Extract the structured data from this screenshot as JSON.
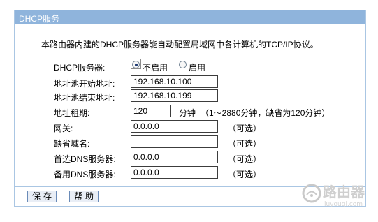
{
  "panel": {
    "title": "DHCP服务",
    "description": "本路由器内建的DHCP服务器能自动配置局域网中各计算机的TCP/IP协议。"
  },
  "dhcp_server": {
    "label": "DHCP服务器:",
    "options": [
      "不启用",
      "启用"
    ],
    "selected": "不启用"
  },
  "fields": {
    "start": {
      "label": "地址池开始地址:",
      "value": "192.168.10.100"
    },
    "end": {
      "label": "地址池结束地址:",
      "value": "192.168.10.199"
    },
    "lease": {
      "label": "地址租期:",
      "value": "120",
      "unit": "分钟",
      "hint": "（1～2880分钟，缺省为120分钟）"
    },
    "gateway": {
      "label": "网关:",
      "value": "0.0.0.0",
      "hint": "（可选）"
    },
    "domain": {
      "label": "缺省域名:",
      "value": "",
      "hint": "（可选）"
    },
    "dns1": {
      "label": "首选DNS服务器:",
      "value": "0.0.0.0",
      "hint": "（可选）"
    },
    "dns2": {
      "label": "备用DNS服务器:",
      "value": "0.0.0.0",
      "hint": "（可选）"
    }
  },
  "buttons": {
    "save": "保存",
    "help": "帮助"
  },
  "watermark": {
    "brand": "路由器",
    "domain": "luyouqi.com"
  },
  "colors": {
    "titlebar": "#8fb4dc",
    "border": "#aac6e3",
    "accent": "#1f3b73"
  }
}
